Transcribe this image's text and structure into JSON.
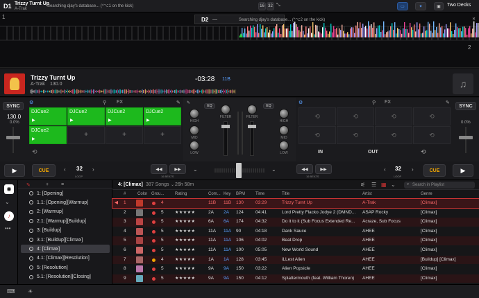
{
  "topbar": {
    "deck1_id": "D1",
    "deck1_title": "Trizzy Turnt Up",
    "deck1_artist": "A-Trak",
    "deck1_status": "Searching djay's database... (^⌥1 on the kick)",
    "beats_a": "16",
    "beats_b": "32",
    "deck2_id": "D2",
    "deck2_title": "—",
    "deck2_status": "Searching djay's database... (^⌥2 on the kick)",
    "layout_label": "Two Decks"
  },
  "waveform": {
    "marker_1": "1",
    "marker_2": "2"
  },
  "deck1": {
    "title": "Trizzy Turnt Up",
    "artist": "A-Trak",
    "bpm_label": "130.0",
    "remaining": "-03:28",
    "key": "11B",
    "sync_label": "SYNC",
    "bpm": "130.0",
    "pitch": "0.0%",
    "fx_label": "FX",
    "pads": [
      "DJCue2",
      "DJCue2",
      "DJCue2",
      "DJCue2",
      "DJCue2"
    ],
    "cue_label": "CUE",
    "loop_value": "32",
    "loop_label": "LOOP",
    "beats_label": "16 BEATS"
  },
  "mixer": {
    "eq_label": "EQ",
    "high": "HIGH",
    "mid": "MID",
    "low": "LOW",
    "filter": "FILTER"
  },
  "deck2": {
    "sync_label": "SYNC",
    "pitch": "0.0%",
    "fx_label": "FX",
    "in_label": "IN",
    "out_label": "OUT",
    "cue_label": "CUE",
    "loop_value": "32",
    "loop_label": "LOOP",
    "beats_label": "16 BEATS"
  },
  "library": {
    "playlist_title": "4: [Climax]",
    "song_count": "387 Songs",
    "duration": "26h 58m",
    "search_placeholder": "Search in Playlist",
    "columns": [
      "#",
      "Color",
      "Grou...",
      "Rating",
      "Com...",
      "Key",
      "BPM",
      "Time",
      "Title",
      "Artist",
      "Genre"
    ],
    "sidebar": [
      "1: [Opening]",
      "1.1: [Opening][Warmup]",
      "2: [Warmup]",
      "2.1: [Warmup][Buildup]",
      "3: [Buildup]",
      "3.1: [Buildup][Climax]",
      "4: [Climax]",
      "4.1: [Climax][Resolution]",
      "5: [Resolution]",
      "5.1: [Resolution][Closing]"
    ],
    "rows": [
      {
        "n": "1",
        "group": "4",
        "rating": "",
        "com": "11B",
        "key": "11B",
        "bpm": "130",
        "time": "03:29",
        "title": "Trizzy Turnt Up",
        "artist": "A-Trak",
        "genre": "[Climax]",
        "color": "#e04040",
        "thumb": "#c0392b"
      },
      {
        "n": "2",
        "group": "5",
        "rating": "★★★★★",
        "com": "2A",
        "key": "2A",
        "bpm": "124",
        "time": "04:41",
        "title": "Lord Pretty Flacko Jodye 2 (DMND...",
        "artist": "ASAP Rocky",
        "genre": "[Climax]",
        "color": "#e04040",
        "thumb": "#777"
      },
      {
        "n": "3",
        "group": "5",
        "rating": "★★★★★",
        "com": "6A",
        "key": "6A",
        "bpm": "174",
        "time": "04:32",
        "title": "Do it to it (Sub Focus Extended Re...",
        "artist": "Acraze, Sub Focus",
        "genre": "[Climax]",
        "color": "#e04040",
        "thumb": "#b44"
      },
      {
        "n": "4",
        "group": "5",
        "rating": "★★★★★",
        "com": "11A",
        "key": "11A",
        "bpm": "90",
        "time": "04:18",
        "title": "Dank Sauce",
        "artist": "AHEE",
        "genre": "[Climax]",
        "color": "#e04040",
        "thumb": "#b55"
      },
      {
        "n": "5",
        "group": "5",
        "rating": "★★★★★",
        "com": "11A",
        "key": "11A",
        "bpm": "106",
        "time": "04:02",
        "title": "Beat Drop",
        "artist": "AHEE",
        "genre": "[Climax]",
        "color": "#e04040",
        "thumb": "#a44"
      },
      {
        "n": "6",
        "group": "5",
        "rating": "★★★★★",
        "com": "11A",
        "key": "11A",
        "bpm": "100",
        "time": "05:05",
        "title": "New World Sound",
        "artist": "AHEE",
        "genre": "[Climax]",
        "color": "#e04040",
        "thumb": "#c66"
      },
      {
        "n": "7",
        "group": "4",
        "rating": "★★★★★",
        "com": "1A",
        "key": "1A",
        "bpm": "128",
        "time": "03:45",
        "title": "iLLest Alien",
        "artist": "AHEE",
        "genre": "[Buildup] [Climax]",
        "color": "#f0a500",
        "thumb": "#a66"
      },
      {
        "n": "8",
        "group": "5",
        "rating": "★★★★★",
        "com": "9A",
        "key": "9A",
        "bpm": "150",
        "time": "03:22",
        "title": "Alien Popsicle",
        "artist": "AHEE",
        "genre": "[Climax]",
        "color": "#e04040",
        "thumb": "#b7a"
      },
      {
        "n": "9",
        "group": "5",
        "rating": "★★★★★",
        "com": "9A",
        "key": "9A",
        "bpm": "150",
        "time": "04:12",
        "title": "Splattermouth (feat. William Thoren)",
        "artist": "AHEE",
        "genre": "[Climax]",
        "color": "#e04040",
        "thumb": "#6ab"
      }
    ]
  }
}
